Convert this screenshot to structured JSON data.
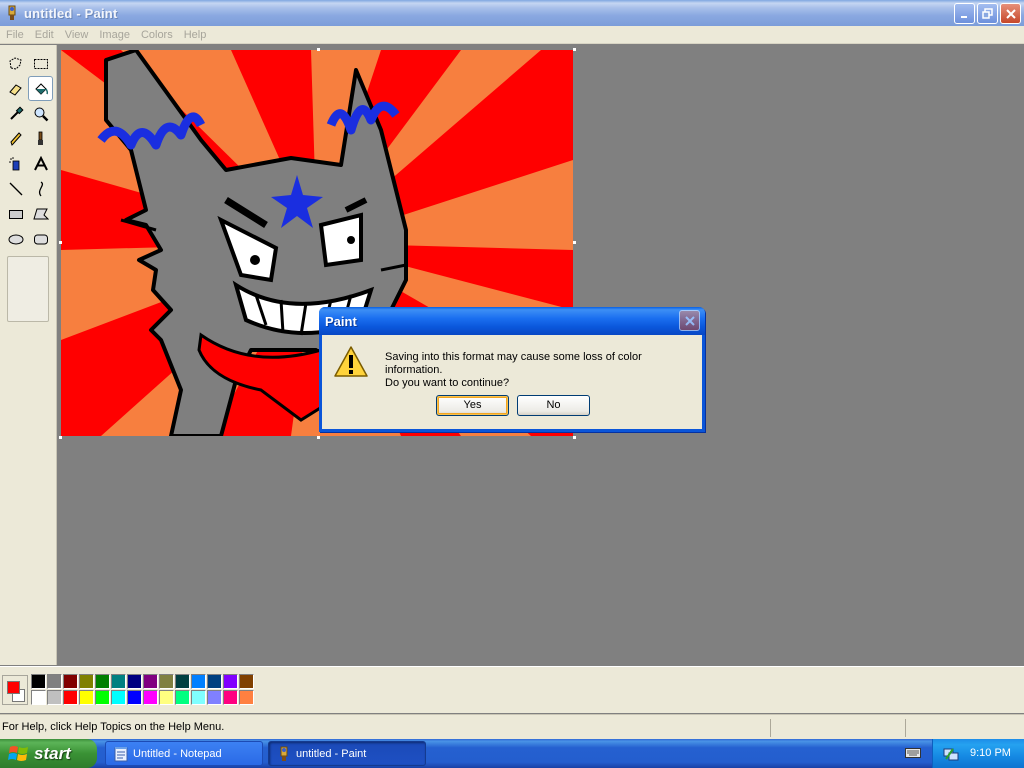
{
  "window": {
    "title": "untitled - Paint",
    "buttons": [
      "minimize",
      "restore",
      "close"
    ]
  },
  "menu": {
    "items": [
      "File",
      "Edit",
      "View",
      "Image",
      "Colors",
      "Help"
    ]
  },
  "toolbox": {
    "tools": [
      {
        "name": "free-form-select",
        "icon": "free-select-icon"
      },
      {
        "name": "select",
        "icon": "rect-select-icon"
      },
      {
        "name": "eraser",
        "icon": "eraser-icon"
      },
      {
        "name": "fill-with-color",
        "icon": "paint-bucket-icon",
        "selected": true
      },
      {
        "name": "pick-color",
        "icon": "eyedropper-icon"
      },
      {
        "name": "magnifier",
        "icon": "magnifier-icon"
      },
      {
        "name": "pencil",
        "icon": "pencil-icon"
      },
      {
        "name": "brush",
        "icon": "brush-icon"
      },
      {
        "name": "airbrush",
        "icon": "airbrush-icon"
      },
      {
        "name": "text",
        "icon": "text-icon"
      },
      {
        "name": "line",
        "icon": "line-icon"
      },
      {
        "name": "curve",
        "icon": "curve-icon"
      },
      {
        "name": "rectangle",
        "icon": "rectangle-icon"
      },
      {
        "name": "polygon",
        "icon": "polygon-icon"
      },
      {
        "name": "ellipse",
        "icon": "ellipse-icon"
      },
      {
        "name": "rounded-rectangle",
        "icon": "rounded-rect-icon"
      }
    ]
  },
  "colors": {
    "foreground": "#ff0000",
    "background": "#ffffff",
    "palette": [
      "#000000",
      "#808080",
      "#800000",
      "#808000",
      "#008000",
      "#008080",
      "#000080",
      "#800080",
      "#808040",
      "#004040",
      "#0080ff",
      "#004080",
      "#8000ff",
      "#804000",
      "#ffffff",
      "#c0c0c0",
      "#ff0000",
      "#ffff00",
      "#00ff00",
      "#00ffff",
      "#0000ff",
      "#ff00ff",
      "#ffff80",
      "#00ff80",
      "#80ffff",
      "#8080ff",
      "#ff0080",
      "#ff8040"
    ]
  },
  "status": {
    "help_text": "For Help, click Help Topics on the Help Menu."
  },
  "dialog": {
    "title": "Paint",
    "icon": "warning-icon",
    "message_line1": "Saving into this format may cause some loss of color information.",
    "message_line2": "Do you want to continue?",
    "yes_label": "Yes",
    "no_label": "No"
  },
  "taskbar": {
    "start_label": "start",
    "tasks": [
      {
        "label": "Untitled - Notepad",
        "icon": "notepad-icon",
        "active": false
      },
      {
        "label": "untitled - Paint",
        "icon": "paint-icon",
        "active": true
      }
    ],
    "clock": "9:10 PM"
  }
}
